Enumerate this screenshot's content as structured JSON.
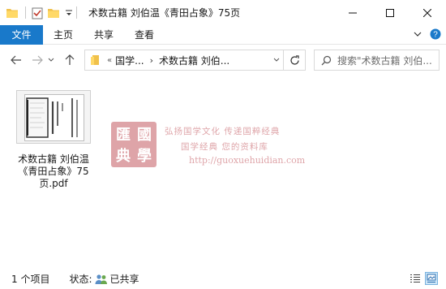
{
  "window": {
    "title": "术数古籍 刘伯温《青田占象》75页",
    "controls": [
      "minimize-icon",
      "maximize-icon",
      "close-icon"
    ]
  },
  "ribbon": {
    "file_tab": "文件",
    "tabs": [
      "主页",
      "共享",
      "查看"
    ]
  },
  "address": {
    "overflow": "«",
    "crumbs": [
      "国学...",
      "术数古籍 刘伯..."
    ]
  },
  "search": {
    "placeholder": "搜索\"术数古籍 刘伯..."
  },
  "file": {
    "name_lines": [
      "术数古籍 刘伯温",
      "《青田占象》75",
      "页.pdf"
    ]
  },
  "watermark": {
    "seal_chars": [
      "匯",
      "國",
      "典",
      "學"
    ],
    "line1": "弘扬国学文化  传递国粹经典",
    "line2": "国学经典 您的资料库",
    "url": "http://guoxuehuidian.com"
  },
  "status": {
    "count": "1 个项目",
    "state_label": "状态:",
    "state_value": "已共享"
  },
  "colors": {
    "accent": "#1979ca",
    "watermark": "#c45a62"
  }
}
